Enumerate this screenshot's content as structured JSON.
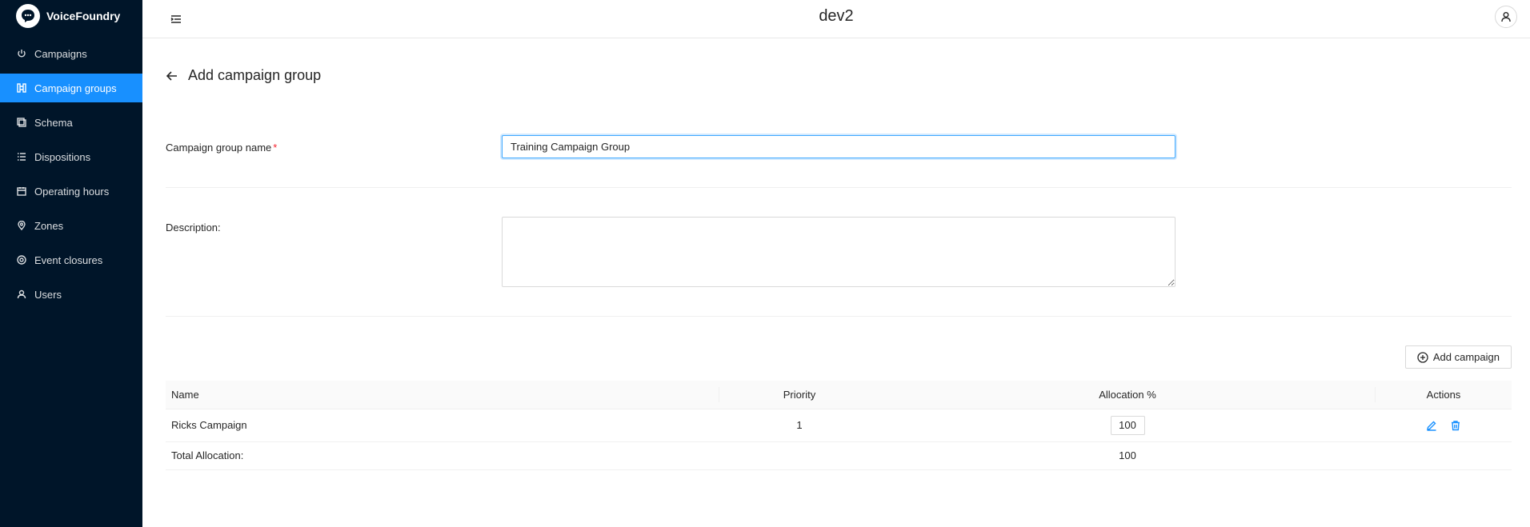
{
  "brand": {
    "name": "VoiceFoundry"
  },
  "header": {
    "title": "dev2"
  },
  "sidebar": {
    "items": [
      {
        "label": "Campaigns",
        "icon": "power-icon"
      },
      {
        "label": "Campaign groups",
        "icon": "group-icon",
        "active": true
      },
      {
        "label": "Schema",
        "icon": "schema-icon"
      },
      {
        "label": "Dispositions",
        "icon": "list-icon"
      },
      {
        "label": "Operating hours",
        "icon": "calendar-icon"
      },
      {
        "label": "Zones",
        "icon": "location-icon"
      },
      {
        "label": "Event closures",
        "icon": "target-icon"
      },
      {
        "label": "Users",
        "icon": "user-icon"
      }
    ]
  },
  "page": {
    "title": "Add campaign group"
  },
  "form": {
    "name_label": "Campaign group name",
    "required_mark": "*",
    "name_value": "Training Campaign Group",
    "description_label": "Description:",
    "description_value": ""
  },
  "table": {
    "add_button": "Add campaign",
    "columns": {
      "name": "Name",
      "priority": "Priority",
      "allocation": "Allocation %",
      "actions": "Actions"
    },
    "rows": [
      {
        "name": "Ricks Campaign",
        "priority": "1",
        "allocation": "100"
      }
    ],
    "total_label": "Total Allocation:",
    "total_value": "100"
  },
  "colors": {
    "sidebar_bg": "#001529",
    "accent": "#1890ff",
    "required": "#f5222d"
  }
}
